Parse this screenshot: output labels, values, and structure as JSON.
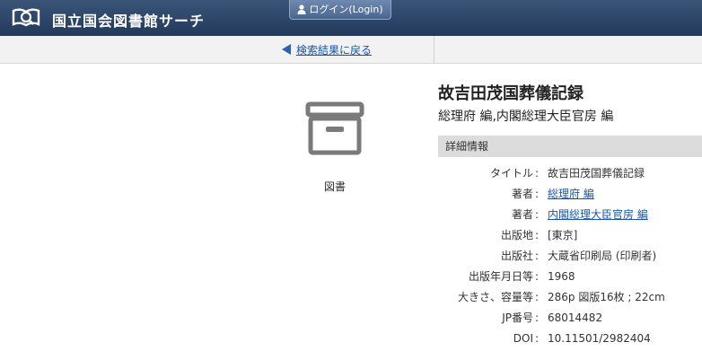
{
  "header": {
    "site_title": "国立国会図書館サーチ",
    "logo_icon": "ndl-book-magnifier-icon",
    "login_label": "ログイン(Login)"
  },
  "nav": {
    "back_label": "検索結果に戻る"
  },
  "item": {
    "type_label": "図書",
    "title": "故吉田茂国葬儀記録",
    "author_line": "総理府 編,内閣総理大臣官房 編"
  },
  "details": {
    "heading": "詳細情報",
    "rows": [
      {
        "label": "タイトル",
        "value": "故吉田茂国葬儀記録",
        "link": false
      },
      {
        "label": "著者",
        "value": "総理府 編",
        "link": true
      },
      {
        "label": "著者",
        "value": "内閣総理大臣官房 編",
        "link": true
      },
      {
        "label": "出版地",
        "value": "[東京]",
        "link": false
      },
      {
        "label": "出版社",
        "value": "大蔵省印刷局 (印刷者)",
        "link": false
      },
      {
        "label": "出版年月日等",
        "value": "1968",
        "link": false
      },
      {
        "label": "大きさ、容量等",
        "value": "286p 図版16枚 ; 22cm",
        "link": false
      },
      {
        "label": "JP番号",
        "value": "68014482",
        "link": false
      },
      {
        "label": "DOI",
        "value": "10.11501/2982404",
        "link": false
      }
    ]
  },
  "colors": {
    "header_bg": "#2c4668",
    "link": "#1a56a8",
    "detail_head_bg": "#dcdcdc"
  }
}
